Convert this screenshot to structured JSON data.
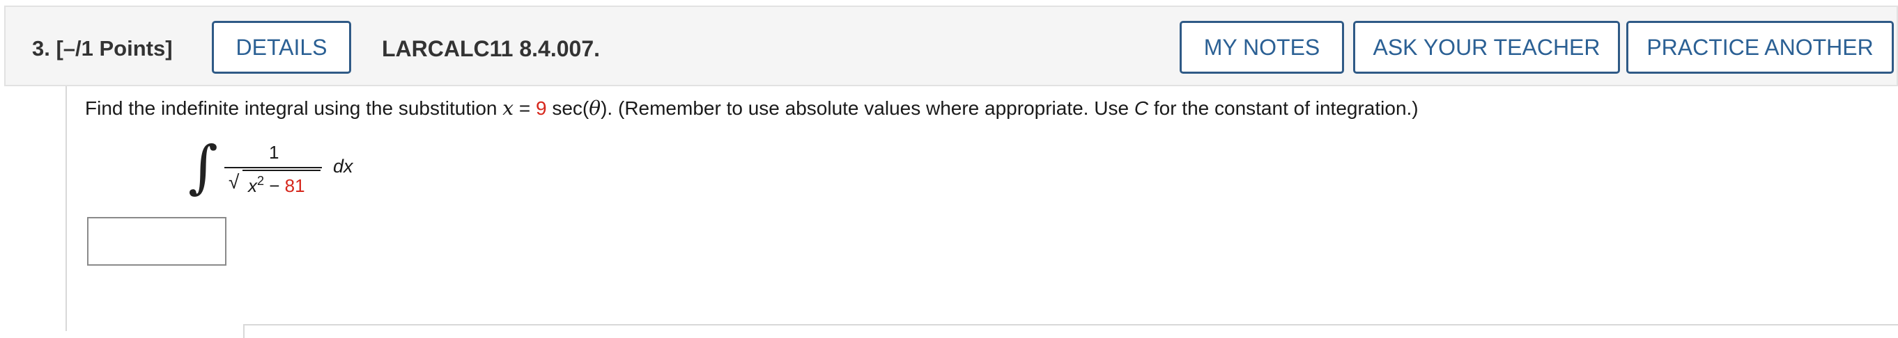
{
  "header": {
    "question_label": "3.  [–/1 Points]",
    "details_label": "DETAILS",
    "problem_code": "LARCALC11 8.4.007.",
    "my_notes_label": "MY NOTES",
    "ask_teacher_label": "ASK YOUR TEACHER",
    "practice_another_label": "PRACTICE ANOTHER"
  },
  "question": {
    "text_before": "Find the indefinite integral using the substitution ",
    "var_x": "x",
    "equals": " = ",
    "coef": "9",
    "sec_part": " sec(",
    "theta": "θ",
    "text_after_theta": "). (Remember to use absolute values where appropriate. Use ",
    "var_c": "C",
    "text_end": " for the constant of integration.)"
  },
  "integral": {
    "sign": "∫",
    "numerator": "1",
    "radical": "√",
    "denom_var": "x",
    "denom_exp": "2",
    "denom_minus": " − ",
    "denom_const": "81",
    "differential": "dx"
  },
  "answer": {
    "value": ""
  },
  "colors": {
    "accent": "#2b6094",
    "button_border": "#2f5a86",
    "highlight_red": "#d6271c",
    "header_bg": "#f5f5f5"
  }
}
